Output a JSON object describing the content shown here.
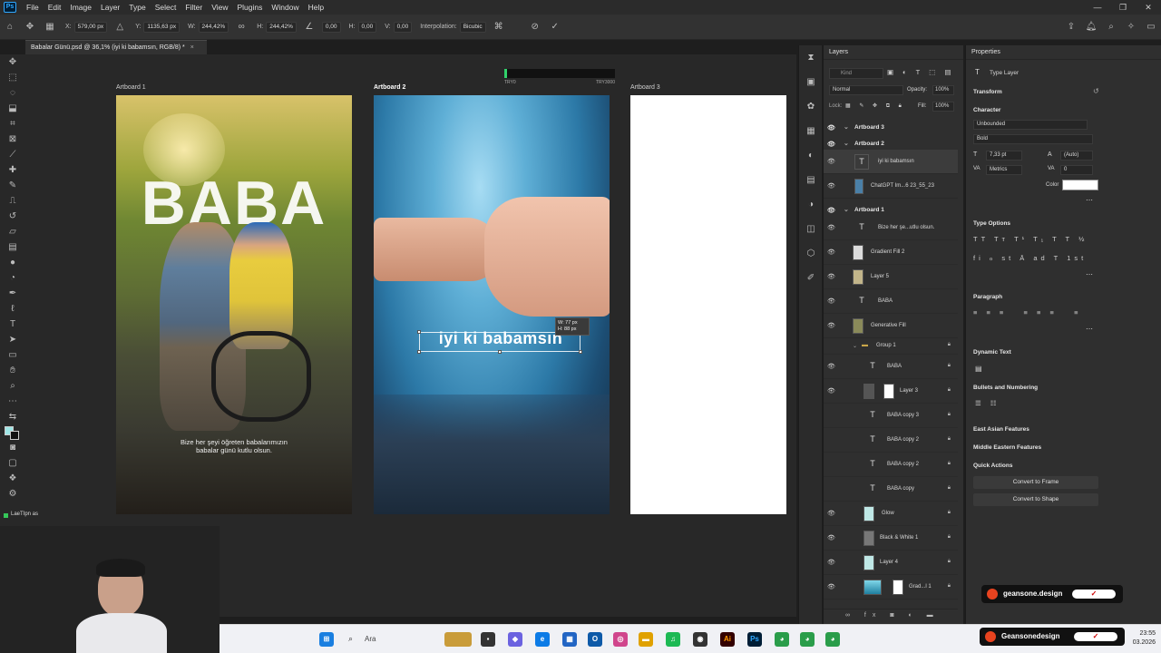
{
  "menu": {
    "items": [
      "File",
      "Edit",
      "Image",
      "Layer",
      "Type",
      "Select",
      "Filter",
      "View",
      "Plugins",
      "Window",
      "Help"
    ]
  },
  "options_bar": {
    "x_label": "X:",
    "x_value": "579,00 px",
    "y_label": "Y:",
    "y_value": "1135,63 px",
    "w_label": "W:",
    "w_value": "244,42%",
    "h_label": "H:",
    "h_value": "244,42%",
    "angle_value": "0,00",
    "hskew_label": "H:",
    "hskew_value": "0,00",
    "vskew_label": "V:",
    "vskew_value": "0,00",
    "interp_label": "Interpolation:",
    "interp_value": "Bicubic"
  },
  "document": {
    "tab_title": "Babalar Günü.psd @ 36,1% (iyi ki babamsın, RGB/8) *",
    "close_glyph": "×"
  },
  "artboards": {
    "ab1_label": "Artboard 1",
    "ab2_label": "Artboard 2",
    "ab3_label": "Artboard 3",
    "ab1_big_word": "BABA",
    "ab1_caption_1": "Bize her şeyi öğreten babalarımızın",
    "ab1_caption_2": "babalar günü kutlu olsun.",
    "ab2_text": "iyi ki babamsın",
    "tip_line1": "W: 77 px",
    "tip_line2": "H: 88 px",
    "ruler_left": "TRY0",
    "ruler_right": "TRY3000"
  },
  "layers_panel": {
    "tab": "Layers",
    "kind_label": "Kind",
    "blend_mode": "Normal",
    "opacity_label": "Opacity:",
    "opacity_value": "100%",
    "lock_label": "Lock:",
    "fill_label": "Fill:",
    "fill_value": "100%",
    "rows": [
      {
        "name": "Artboard 3"
      },
      {
        "name": "Artboard 2"
      },
      {
        "name": "iyi ki babamsın"
      },
      {
        "name": "ChatGPT Im...6 23_55_23"
      },
      {
        "name": "Artboard 1"
      },
      {
        "name": "Bize her şe...utlu olsun."
      },
      {
        "name": "Gradient Fill 2"
      },
      {
        "name": "Layer 5"
      },
      {
        "name": "BABA"
      },
      {
        "name": "Generative Fill"
      },
      {
        "name": "Group 1"
      },
      {
        "name": "BABA"
      },
      {
        "name": "Layer 3"
      },
      {
        "name": "BABA copy 3"
      },
      {
        "name": "BABA copy 2"
      },
      {
        "name": "BABA copy 2"
      },
      {
        "name": "BABA copy"
      },
      {
        "name": "Glow"
      },
      {
        "name": "Black & White 1"
      },
      {
        "name": "Layer 4"
      },
      {
        "name": "Grad...l 1"
      }
    ]
  },
  "properties": {
    "tab": "Properties",
    "layer_type": "Type Layer",
    "transform": "Transform",
    "character": "Character",
    "font_family": "Unbounded",
    "font_style": "Bold",
    "size": "7,33 pt",
    "leading": "(Auto)",
    "kerning": "Metrics",
    "tracking": "0",
    "color_label": "Color",
    "type_options": "Type Options",
    "paragraph": "Paragraph",
    "dynamic_text": "Dynamic Text",
    "bullets": "Bullets and Numbering",
    "east_asian": "East Asian Features",
    "middle_eastern": "Middle Eastern Features",
    "quick_actions": "Quick Actions",
    "convert_frame": "Convert to Frame",
    "convert_shape": "Convert to Shape"
  },
  "status": {
    "doc_info": "LaeTIpn as"
  },
  "taskbar": {
    "search": "Ara",
    "time": "23:55",
    "date": "03.2026"
  },
  "badges": {
    "small": "geansone.design",
    "large": "Geansonedesign"
  },
  "colors": {
    "accent": "#31a8ff",
    "panel": "#2f2f2f",
    "selection": "#3c3c3c"
  }
}
